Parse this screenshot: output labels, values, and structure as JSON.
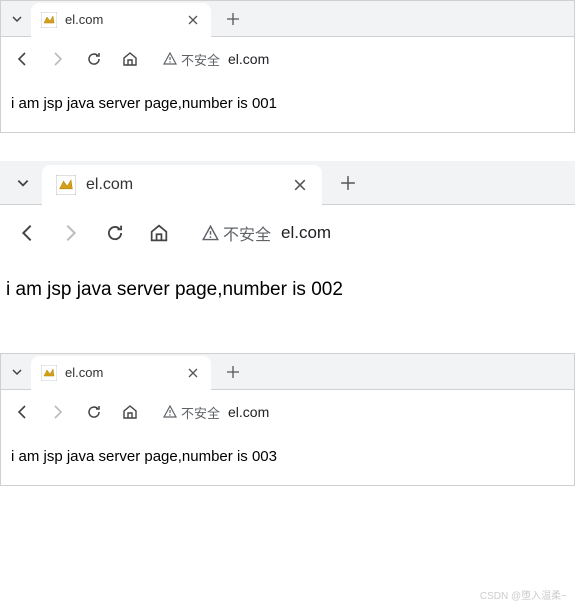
{
  "windows": [
    {
      "tab_title": "el.com",
      "security_label": "不安全",
      "url": "el.com",
      "content": "i am jsp java server page,number is 001"
    },
    {
      "tab_title": "el.com",
      "security_label": "不安全",
      "url": "el.com",
      "content": "i am jsp java server page,number is 002"
    },
    {
      "tab_title": "el.com",
      "security_label": "不安全",
      "url": "el.com",
      "content": "i am jsp java server page,number is 003"
    }
  ],
  "watermark": "CSDN @堕入温柔~"
}
